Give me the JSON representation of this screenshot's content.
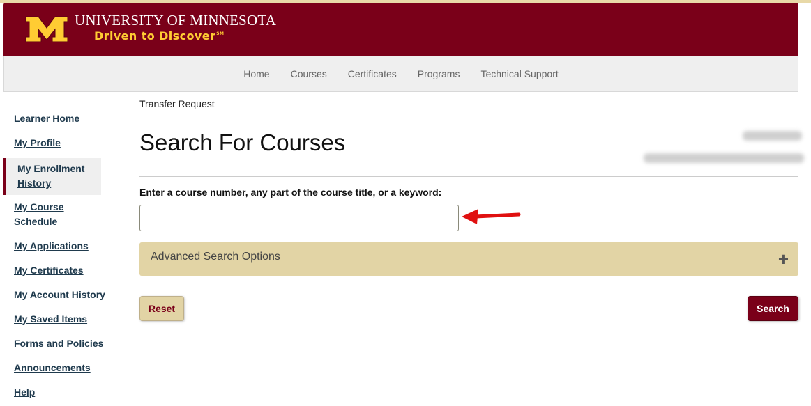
{
  "header": {
    "university_name": "UNIVERSITY OF MINNESOTA",
    "tagline": "Driven to Discover",
    "tagline_mark": "SM",
    "logo_icon": "block-m-logo",
    "brand_color": "#7a0019",
    "accent_color": "#ffcc33"
  },
  "nav": {
    "items": [
      "Home",
      "Courses",
      "Certificates",
      "Programs",
      "Technical Support"
    ]
  },
  "sidebar": {
    "items": [
      {
        "label": "Learner Home"
      },
      {
        "label": "My Profile"
      },
      {
        "label": "My Enrollment History",
        "active": true
      },
      {
        "label": "My Course Schedule"
      },
      {
        "label": "My Applications"
      },
      {
        "label": "My Certificates"
      },
      {
        "label": "My Account History"
      },
      {
        "label": "My Saved Items"
      },
      {
        "label": "Forms and Policies"
      },
      {
        "label": "Announcements"
      },
      {
        "label": "Help"
      }
    ]
  },
  "main": {
    "breadcrumb": "Transfer Request",
    "title": "Search For Courses",
    "search_label": "Enter a course number, any part of the course title, or a keyword:",
    "search_value": "",
    "advanced_label": "Advanced Search Options",
    "advanced_icon": "plus-icon",
    "reset_label": "Reset",
    "search_button_label": "Search",
    "annotation_icon": "red-arrow-icon"
  }
}
